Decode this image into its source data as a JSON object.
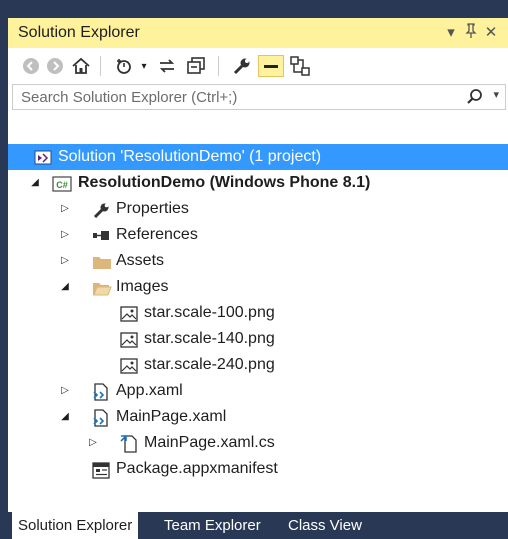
{
  "panel": {
    "title": "Solution Explorer",
    "dropdown_icon": "▾",
    "pin_icon": "⨠",
    "close_icon": "✕"
  },
  "toolbar": {
    "icons": [
      "back-icon",
      "forward-icon",
      "home-icon",
      "pending-changes-filter-icon",
      "dropdown-icon",
      "sync-icon",
      "collapse-all-icon",
      "properties-icon",
      "preview-selected-icon",
      "class-diagram-icon"
    ]
  },
  "search": {
    "placeholder": "Search Solution Explorer (Ctrl+;)",
    "icon": "⌕"
  },
  "tree": {
    "solution": "Solution 'ResolutionDemo' (1 project)",
    "project": "ResolutionDemo (Windows Phone 8.1)",
    "properties": "Properties",
    "references": "References",
    "assets": "Assets",
    "images": "Images",
    "img1": "star.scale-100.png",
    "img2": "star.scale-140.png",
    "img3": "star.scale-240.png",
    "app": "App.xaml",
    "mainpage": "MainPage.xaml",
    "mainpagecs": "MainPage.xaml.cs",
    "manifest": "Package.appxmanifest"
  },
  "tabs": {
    "solution_explorer": "Solution Explorer",
    "team_explorer": "Team Explorer",
    "class_view": "Class View"
  },
  "colors": {
    "title_bar": "#fff29d",
    "selection": "#3399ff",
    "tab_strip": "#293955"
  }
}
